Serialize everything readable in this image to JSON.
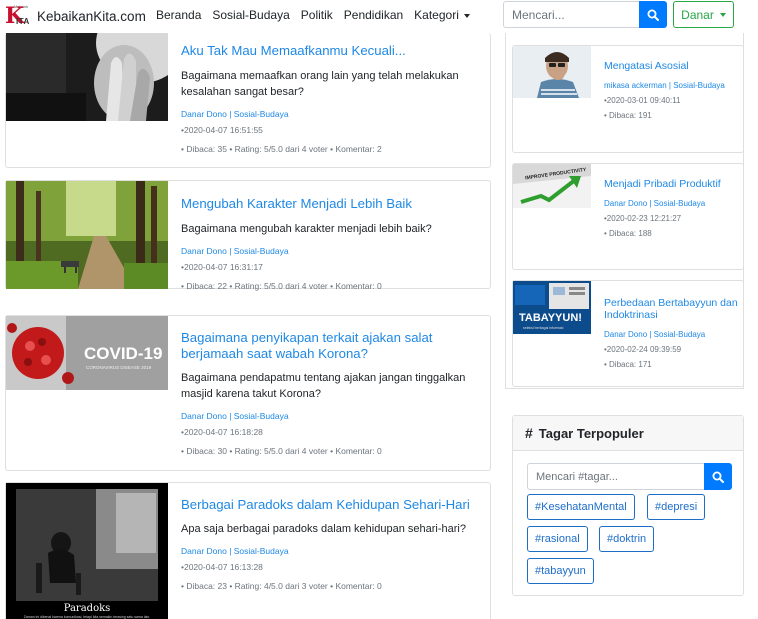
{
  "brand": {
    "logo_small_text": "Majalah",
    "logo_letter": "K",
    "logo_sub": "ITA",
    "name": "KebaikanKita.com"
  },
  "nav": {
    "items": [
      "Beranda",
      "Sosial-Budaya",
      "Politik",
      "Pendidikan",
      "Kategori"
    ]
  },
  "search": {
    "placeholder": "Mencari..."
  },
  "user": {
    "label": "Danar"
  },
  "articles": [
    {
      "title": "Aku Tak Mau Memaafkanmu Kecuali...",
      "desc": "Bagaimana memaafkan orang lain yang telah melakukan kesalahan sangat besar?",
      "author": "Danar Dono | Sosial-Budaya",
      "date": "•2020-04-07 16:51:55",
      "stats": "• Dibaca: 35 • Rating: 5/5.0 dari 4 voter • Komentar: 2"
    },
    {
      "title": "Mengubah Karakter Menjadi Lebih Baik",
      "desc": "Bagaimana mengubah karakter menjadi lebih baik?",
      "author": "Danar Dono | Sosial-Budaya",
      "date": "•2020-04-07 16:31:17",
      "stats": "• Dibaca: 22 • Rating: 5/5.0 dari 4 voter • Komentar: 0"
    },
    {
      "title": "Bagaimana penyikapan terkait ajakan salat berjamaah saat wabah Korona?",
      "desc": "Bagaimana pendapatmu tentang ajakan jangan tinggalkan masjid karena takut Korona?",
      "author": "Danar Dono | Sosial-Budaya",
      "date": "•2020-04-07 16:18:28",
      "stats": "• Dibaca: 30 • Rating: 5/5.0 dari 4 voter • Komentar: 0",
      "thumb_text": "COVID-19",
      "thumb_sub": "CORONAVIRUS DISEASE 2019"
    },
    {
      "title": "Berbagai Paradoks dalam Kehidupan Sehari-Hari",
      "desc": "Apa saja berbagai paradoks dalam kehidupan sehari-hari?",
      "author": "Danar Dono | Sosial-Budaya",
      "date": "•2020-04-07 16:13:28",
      "stats": "• Dibaca: 23 • Rating: 4/5.0 dari 3 voter • Komentar: 0",
      "thumb_text": "Paradoks",
      "thumb_sub": "Zaman ini dikenal karena komunikasi, tetapi kita semakin terasing satu sama lain."
    }
  ],
  "sidebar": [
    {
      "title": "Mengatasi Asosial",
      "author": "mikasa ackerman | Sosial-Budaya",
      "date": "•2020-03-01 09:40:11",
      "stats": "• Dibaca: 191"
    },
    {
      "title": "Menjadi Pribadi Produktif",
      "author": "Danar Dono | Sosial-Budaya",
      "date": "•2020-02-23 12:21:27",
      "stats": "• Dibaca: 188",
      "thumb_text": "IMPROVE PRODUCTIVITY"
    },
    {
      "title": "Perbedaan Bertabayyun dan Indoktrinasi",
      "author": "Danar Dono | Sosial-Budaya",
      "date": "•2020-02-24 09:39:59",
      "stats": "• Dibaca: 171",
      "thumb_text": "TABAYYUN!",
      "thumb_sub": "seleksi berbagai informasi"
    }
  ],
  "tags": {
    "heading": "Tagar Terpopuler",
    "search_placeholder": "Mencari #tagar...",
    "items": [
      "#KesehatanMental",
      "#depresi",
      "#rasional",
      "#doktrin",
      "#tabayyun"
    ]
  },
  "colors": {
    "link": "#1e88e5",
    "primary": "#007bff",
    "success": "#28a745",
    "logo_red": "#c8102e"
  },
  "icons": {
    "search": "search-icon",
    "caret": "caret-down-icon",
    "hash": "hash-icon"
  }
}
